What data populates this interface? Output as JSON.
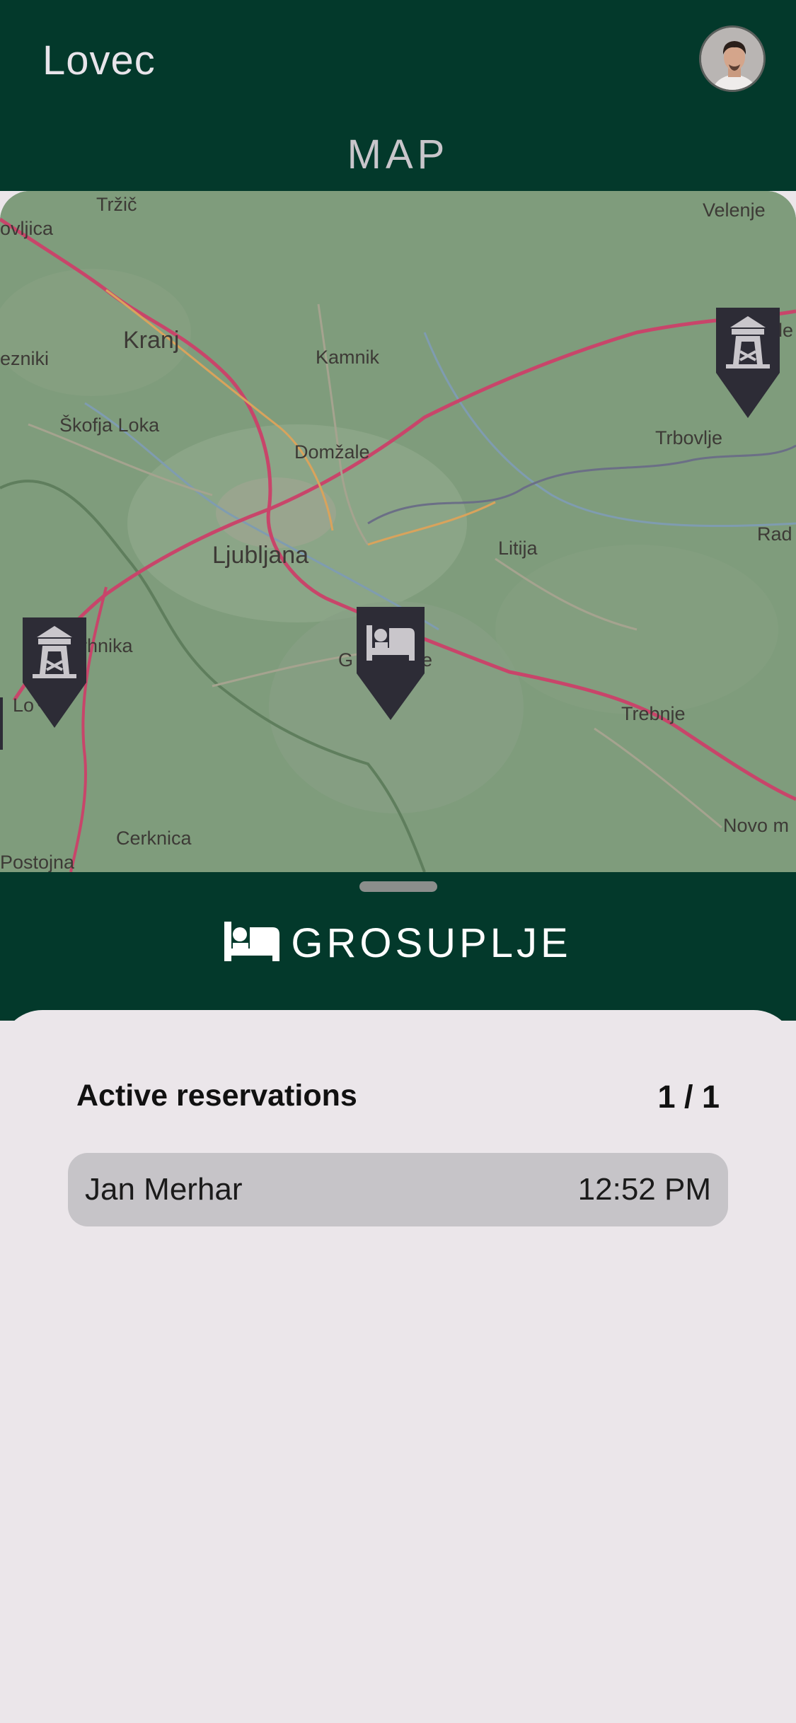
{
  "app": {
    "title": "Lovec"
  },
  "header": {
    "screen_title": "MAP"
  },
  "map": {
    "places": [
      {
        "name": "Tržič",
        "key": "trzic"
      },
      {
        "name": "Velenje",
        "key": "velenje"
      },
      {
        "name": "ovljica",
        "key": "ovljica"
      },
      {
        "name": "Kranj",
        "key": "kranj"
      },
      {
        "name": "Kamnik",
        "key": "kamnik"
      },
      {
        "name": "ezniki",
        "key": "ezniki"
      },
      {
        "name": "Škofja Loka",
        "key": "skofja-loka"
      },
      {
        "name": "Domžale",
        "key": "domzale"
      },
      {
        "name": "Trbovlje",
        "key": "trbovlje"
      },
      {
        "name": "Ljubljana",
        "key": "ljubljana"
      },
      {
        "name": "Litija",
        "key": "litija"
      },
      {
        "name": "Rad",
        "key": "rad"
      },
      {
        "name": "rhnika",
        "key": "rhnika"
      },
      {
        "name": "G",
        "key": "g"
      },
      {
        "name": "e",
        "key": "e"
      },
      {
        "name": "Lo",
        "key": "lo"
      },
      {
        "name": "ec",
        "key": "ec"
      },
      {
        "name": "Trebnje",
        "key": "trebnje"
      },
      {
        "name": "Cerknica",
        "key": "cerknica"
      },
      {
        "name": "Novo m",
        "key": "novo-m"
      },
      {
        "name": "Postojna",
        "key": "postojna"
      },
      {
        "name": "le",
        "key": "le"
      }
    ],
    "markers": [
      {
        "type": "tower-icon"
      },
      {
        "type": "tower-icon"
      },
      {
        "type": "bed-icon"
      }
    ]
  },
  "sheet": {
    "icon": "bed-icon",
    "title": "GROSUPLJE",
    "section_label": "Active reservations",
    "count": "1 / 1",
    "reservations": [
      {
        "name": "Jan Merhar",
        "time": "12:52 PM"
      }
    ]
  },
  "colors": {
    "primary": "#03392b",
    "surface": "#ebe6ea",
    "row": "#c6c4c8",
    "marker": "#2d2c36"
  }
}
